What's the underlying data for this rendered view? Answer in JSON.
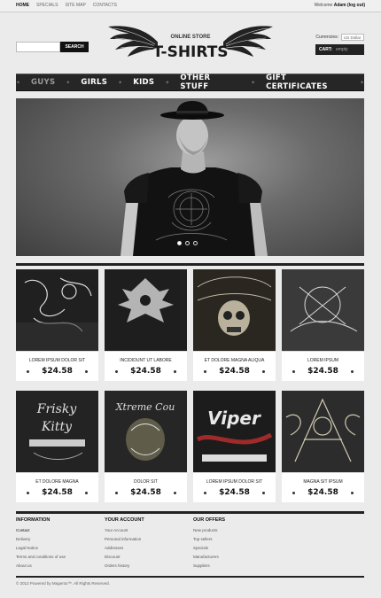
{
  "topbar": {
    "nav": [
      "HOME",
      "SPECIALS",
      "SITE MAP",
      "CONTACTS"
    ],
    "welcome_prefix": "Welcome",
    "welcome_user": "Adam",
    "logout": "(log out)"
  },
  "search": {
    "placeholder": "",
    "button": "SEARCH"
  },
  "logo": {
    "subtitle": "ONLINE STORE",
    "title": "T-SHIRTS"
  },
  "currency": {
    "label": "Currencies:",
    "value": "US Dollar"
  },
  "cart": {
    "label": "CART:",
    "value": "empty"
  },
  "mainnav": [
    "GUYS",
    "GIRLS",
    "KIDS",
    "OTHER STUFF",
    "GIFT CERTIFICATES"
  ],
  "products": [
    {
      "name": "LOREM IPSUM DOLOR SIT",
      "price": "$24.58"
    },
    {
      "name": "INCIDIDUNT UT LABORE",
      "price": "$24.58"
    },
    {
      "name": "ET DOLORE MAGNA ALIQUA",
      "price": "$24.58"
    },
    {
      "name": "LOREM IPSUM",
      "price": "$24.58"
    },
    {
      "name": "ET DOLORE MAGNA",
      "price": "$24.58"
    },
    {
      "name": "DOLOR SIT",
      "price": "$24.58"
    },
    {
      "name": "LOREM IPSUM DOLOR SIT",
      "price": "$24.58"
    },
    {
      "name": "MAGNA SIT IPSUM",
      "price": "$24.58"
    }
  ],
  "footer": {
    "information": {
      "title": "INFORMATION",
      "links": [
        "Contact",
        "Delivery",
        "Legal Notice",
        "Terms and conditions of use",
        "About us"
      ]
    },
    "account": {
      "title": "YOUR ACCOUNT",
      "links": [
        "Your Account",
        "Personal information",
        "Addresses",
        "Discount",
        "Orders history"
      ]
    },
    "offers": {
      "title": "OUR OFFERS",
      "links": [
        "New products",
        "Top sellers",
        "Specials",
        "Manufacturers",
        "Suppliers"
      ]
    }
  },
  "copyright": "© 2012 Powered by Magento™. All Rights Reserved."
}
